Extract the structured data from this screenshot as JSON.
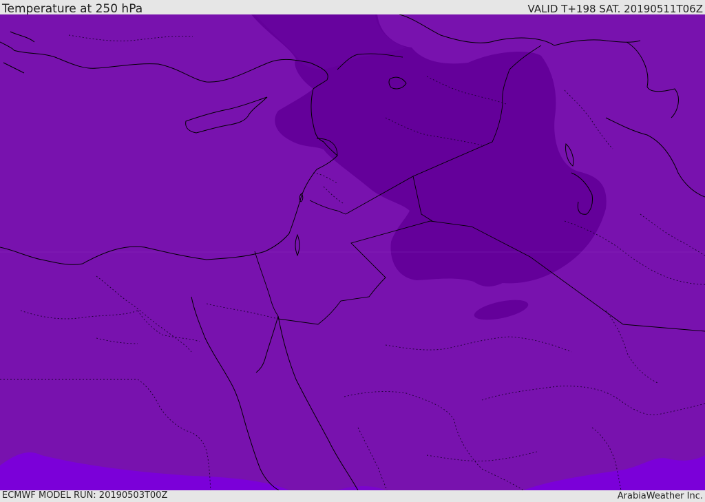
{
  "header": {
    "title": "Temperature at 250 hPa",
    "valid_time": "VALID T+198 SAT. 20190511T06Z"
  },
  "footer": {
    "model_run": "ECMWF MODEL RUN: 20190503T00Z",
    "credit": "ArabiaWeather Inc."
  },
  "colors": {
    "field_base": "#7812ae",
    "field_cold": "#64009a",
    "field_warm": "#7b00d9",
    "coastline": "#000000",
    "border_dotted": "#1a0030",
    "bars": "#e6e6e6"
  }
}
